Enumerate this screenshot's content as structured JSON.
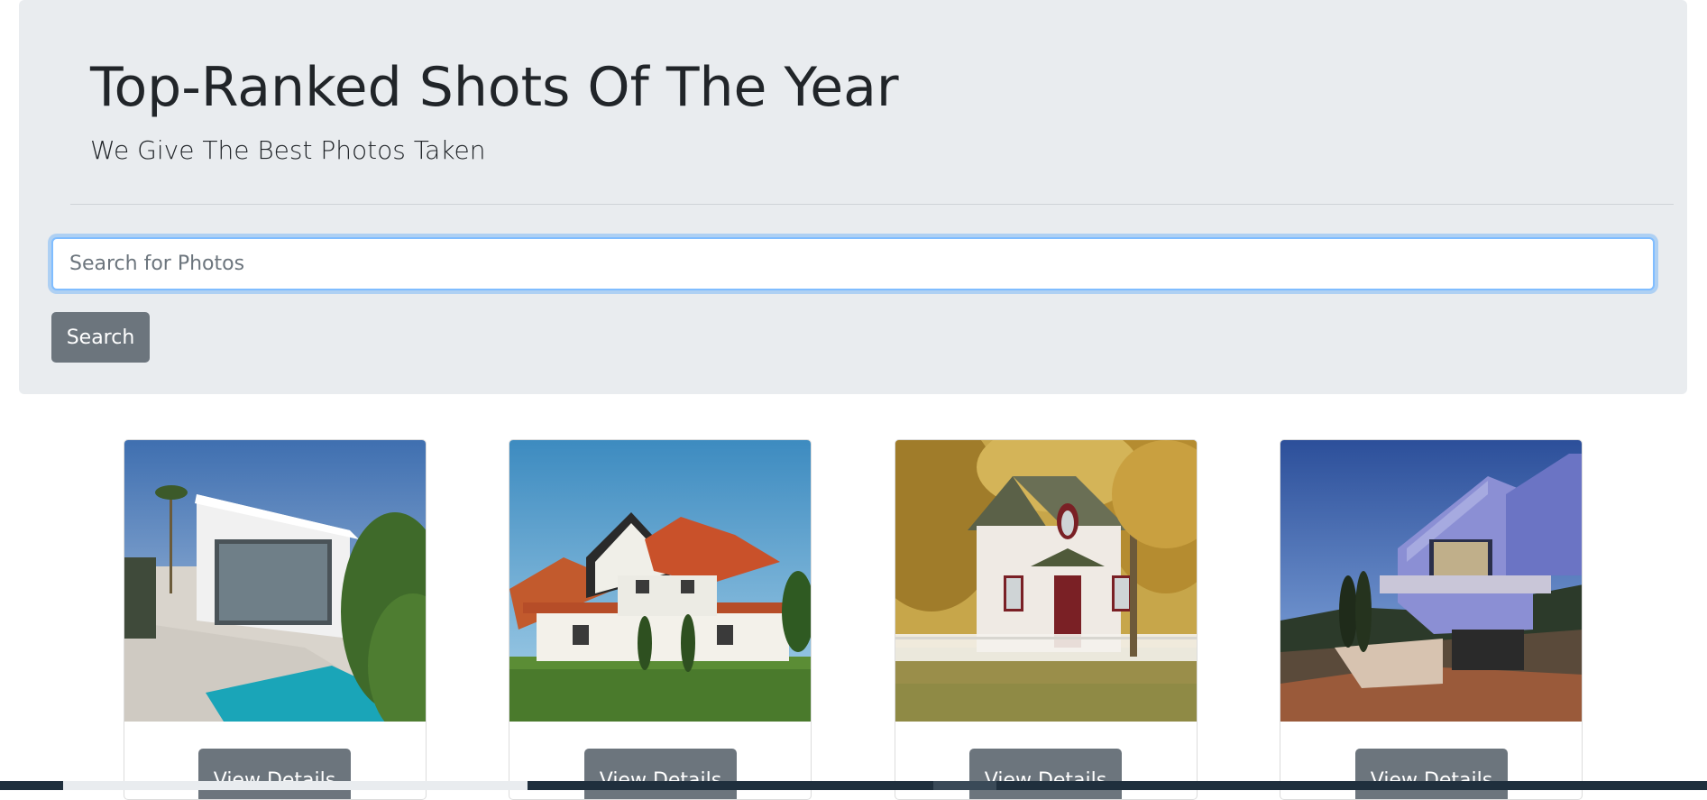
{
  "header": {
    "title": "Top-Ranked Shots Of The Year",
    "subtitle": "We Give The Best Photos Taken"
  },
  "search": {
    "placeholder": "Search for Photos",
    "button_label": "Search"
  },
  "cards": [
    {
      "button_label": "View Details",
      "image": "modern-white-house-with-pool-photo"
    },
    {
      "button_label": "View Details",
      "image": "tudor-style-house-photo"
    },
    {
      "button_label": "View Details",
      "image": "white-cottage-autumn-photo"
    },
    {
      "button_label": "View Details",
      "image": "modern-house-at-dusk-photo"
    }
  ],
  "colors": {
    "jumbotron_bg": "#e9ecef",
    "button_secondary": "#6c757d",
    "focus_border": "#80bdff"
  }
}
